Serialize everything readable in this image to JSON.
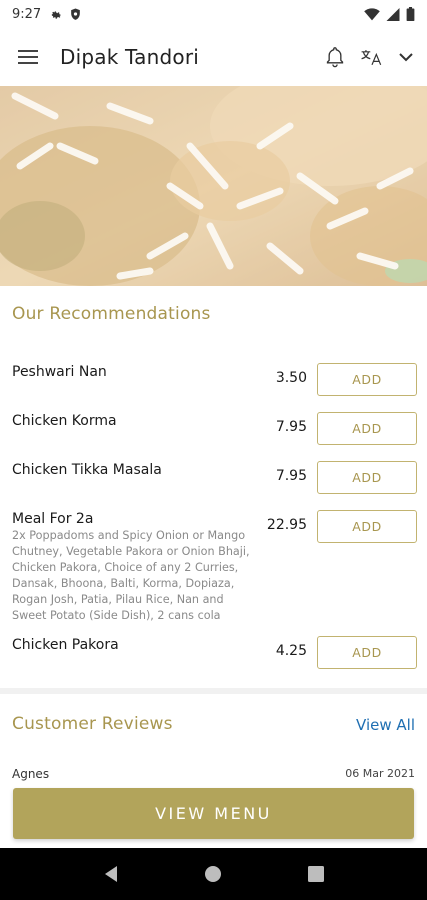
{
  "status_bar": {
    "time": "9:27",
    "icons": [
      "gear-icon",
      "shield-icon",
      "wifi-icon",
      "signal-icon",
      "battery-icon"
    ]
  },
  "app_bar": {
    "title": "Dipak Tandori",
    "icons": [
      "menu-icon",
      "bell-icon",
      "language-icon",
      "chevron-down-icon"
    ]
  },
  "hero": {
    "image": "food-photo"
  },
  "recommendations": {
    "title": "Our Recommendations",
    "add_label": "ADD",
    "items": [
      {
        "name": "Peshwari Nan",
        "price": "3.50",
        "description": ""
      },
      {
        "name": "Chicken Korma",
        "price": "7.95",
        "description": ""
      },
      {
        "name": "Chicken Tikka Masala",
        "price": "7.95",
        "description": ""
      },
      {
        "name": "Meal For 2a",
        "price": "22.95",
        "description": "2x Poppadoms and Spicy Onion or Mango Chutney, Vegetable Pakora or Onion Bhaji, Chicken Pakora, Choice of any 2 Curries, Dansak, Bhoona, Balti, Korma, Dopiaza, Rogan Josh, Patia, Pilau Rice, Nan and Sweet Potato (Side Dish), 2 cans cola"
      },
      {
        "name": "Chicken Pakora",
        "price": "4.25",
        "description": ""
      }
    ]
  },
  "reviews": {
    "title": "Customer Reviews",
    "view_all": "View All",
    "first_author": "Agnes",
    "first_date": "06 Mar 2021"
  },
  "view_menu": {
    "label": "VIEW MENU"
  },
  "colors": {
    "accent": "#a8964f",
    "button_fill": "#b2a45b",
    "link": "#1f6fb2"
  }
}
